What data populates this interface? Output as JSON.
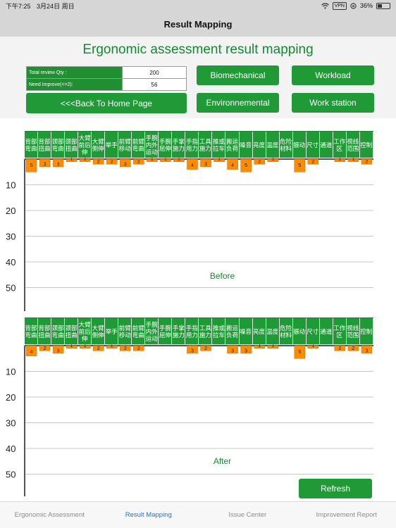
{
  "status": {
    "time": "下午7:25",
    "date": "3月24日 周日",
    "vpn": "VPN",
    "battery": "36%",
    "battery_level": 0.36
  },
  "nav": {
    "title": "Result Mapping"
  },
  "header": {
    "title": "Ergonomic assessment result  mapping"
  },
  "summary": {
    "total_label": "Total review Qty :",
    "total_value": "200",
    "improve_label": "Need Improve(<=2):",
    "improve_value": "56"
  },
  "buttons": {
    "back": "<<<Back To Home Page",
    "biomechanical": "Biomechanical",
    "workload": "Workload",
    "environmental": "Environnemental",
    "workstation": "Work station",
    "refresh": "Refresh"
  },
  "columns": [
    "背部弯曲",
    "背部扭曲",
    "颈部弯曲",
    "颈部扭曲",
    "大臂前后伸",
    "大臂侧伸",
    "举手",
    "前臂移动",
    "前臂弯曲",
    "手腕内外运动",
    "手腕屈伸",
    "手掌施力",
    "手指用力",
    "工具施力",
    "推或拉车",
    "搬运负荷",
    "噪音",
    "亮度",
    "温度",
    "危险材料",
    "振动",
    "尺寸",
    "通道",
    "工作区",
    "视线范围",
    "控制"
  ],
  "chart_data": [
    {
      "type": "bar",
      "title": "Before",
      "categories": [
        "背部弯曲",
        "背部扭曲",
        "颈部弯曲",
        "颈部扭曲",
        "大臂前后伸",
        "大臂侧伸",
        "举手",
        "前臂移动",
        "前臂弯曲",
        "手腕内外运动",
        "手腕屈伸",
        "手掌施力",
        "手指用力",
        "工具施力",
        "推或拉车",
        "搬运负荷",
        "噪音",
        "亮度",
        "温度",
        "危险材料",
        "振动",
        "尺寸",
        "通道",
        "工作区",
        "视线范围",
        "控制"
      ],
      "values": [
        5,
        3,
        3,
        1,
        1,
        2,
        2,
        3,
        2,
        1,
        1,
        1,
        4,
        3,
        1,
        4,
        5,
        2,
        1,
        0,
        5,
        2,
        0,
        1,
        1,
        2
      ],
      "yticks": [
        10,
        20,
        30,
        40,
        50
      ],
      "ylim": [
        0,
        55
      ],
      "bar_color": "#ff8c00"
    },
    {
      "type": "bar",
      "title": "After",
      "categories": [
        "背部弯曲",
        "背部扭曲",
        "颈部弯曲",
        "颈部扭曲",
        "大臂前后伸",
        "大臂侧伸",
        "举手",
        "前臂移动",
        "前臂弯曲",
        "手腕内外运动",
        "手腕屈伸",
        "手掌施力",
        "手指用力",
        "工具施力",
        "推或拉车",
        "搬运负荷",
        "噪音",
        "亮度",
        "温度",
        "危险材料",
        "振动",
        "尺寸",
        "通道",
        "工作区",
        "视线范围",
        "控制"
      ],
      "values": [
        4,
        2,
        3,
        1,
        1,
        2,
        1,
        2,
        2,
        0,
        0,
        0,
        3,
        2,
        0,
        3,
        3,
        1,
        1,
        0,
        5,
        1,
        0,
        2,
        2,
        3
      ],
      "yticks": [
        10,
        20,
        30,
        40,
        50
      ],
      "ylim": [
        0,
        55
      ],
      "bar_color": "#ff8c00"
    }
  ],
  "tabs": [
    {
      "label": "Ergonomic Assessment",
      "active": false
    },
    {
      "label": "Result Mapping",
      "active": true
    },
    {
      "label": "Issue Center",
      "active": false
    },
    {
      "label": "Improvement Report",
      "active": false
    }
  ]
}
